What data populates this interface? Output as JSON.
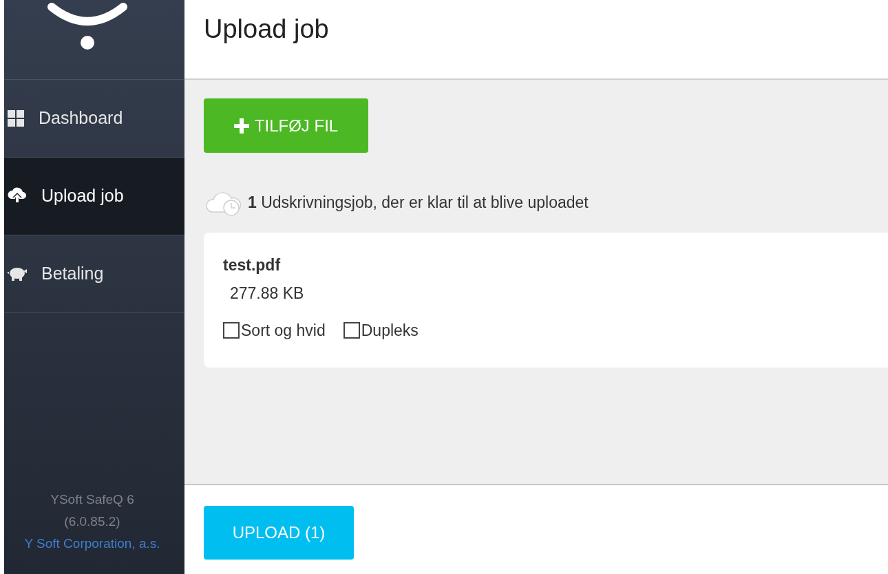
{
  "sidebar": {
    "items": [
      {
        "kind": "dashboard",
        "label": "Dashboard",
        "selected": false
      },
      {
        "kind": "upload",
        "label": "Upload job",
        "selected": true
      },
      {
        "kind": "payment",
        "label": "Betaling",
        "selected": false
      }
    ],
    "footer": {
      "product": "YSoft SafeQ 6",
      "version": "(6.0.85.2)",
      "company": "Y Soft Corporation, a.s."
    }
  },
  "header": {
    "title": "Upload job"
  },
  "add_button": "TILFØJ FIL",
  "status_message": "**1** Udskrivningsjob, der er klar til at blive uploadet",
  "jobs": [
    {
      "name": "test.pdf",
      "size": "277.88 KB",
      "options": [
        {
          "label": "Sort og hvid",
          "checked": false
        },
        {
          "label": "Dupleks",
          "checked": false
        }
      ]
    }
  ],
  "upload_button": "UPLOAD (1)"
}
